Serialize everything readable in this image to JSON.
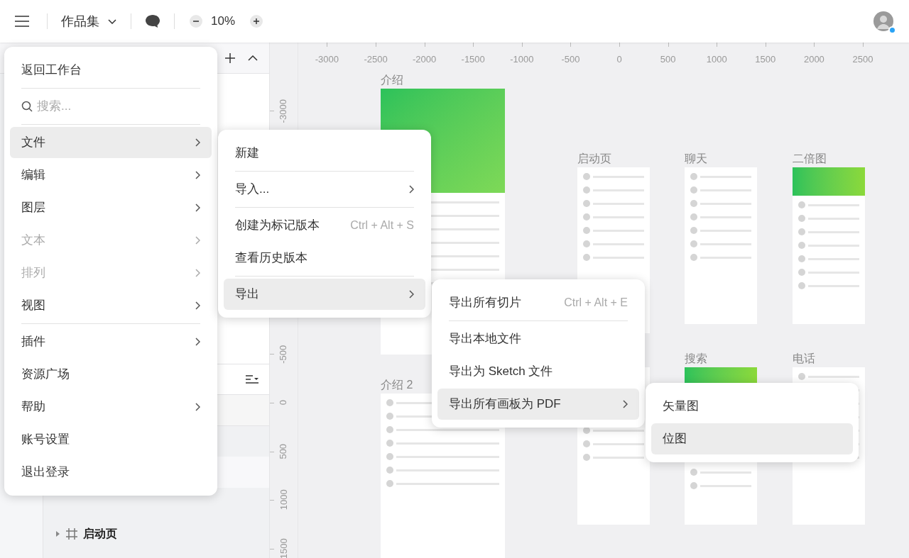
{
  "toolbar": {
    "document_title": "作品集",
    "zoom": "10%"
  },
  "rulers": {
    "horizontal": [
      "-3000",
      "-2500",
      "-2000",
      "-1500",
      "-1000",
      "-500",
      "0",
      "500",
      "1000",
      "1500",
      "2000",
      "2500"
    ],
    "vertical": [
      "-3000",
      "-500",
      "0",
      "500",
      "1000",
      "1500"
    ]
  },
  "artboards": [
    {
      "label": "介绍",
      "kind": "promo"
    },
    {
      "label": "启动页",
      "kind": "plain"
    },
    {
      "label": "聊天",
      "kind": "plain"
    },
    {
      "label": "二倍图",
      "kind": "green_header"
    },
    {
      "label": "介绍 2",
      "kind": "plain"
    },
    {
      "kind": "plain"
    },
    {
      "label": "搜索",
      "kind": "green_header"
    },
    {
      "label": "电话",
      "kind": "plain"
    }
  ],
  "layers": [
    {
      "label": "启动页",
      "expanded": false
    }
  ],
  "main_menu": [
    {
      "kind": "action",
      "label": "返回工作台",
      "selected": false,
      "disabled": false
    },
    {
      "kind": "divider"
    },
    {
      "kind": "search",
      "placeholder": "搜索..."
    },
    {
      "kind": "divider"
    },
    {
      "kind": "submenu",
      "label": "文件",
      "selected": true,
      "disabled": false
    },
    {
      "kind": "submenu",
      "label": "编辑",
      "selected": false,
      "disabled": false
    },
    {
      "kind": "submenu",
      "label": "图层",
      "selected": false,
      "disabled": false
    },
    {
      "kind": "submenu",
      "label": "文本",
      "selected": false,
      "disabled": true
    },
    {
      "kind": "submenu",
      "label": "排列",
      "selected": false,
      "disabled": true
    },
    {
      "kind": "submenu",
      "label": "视图",
      "selected": false,
      "disabled": false
    },
    {
      "kind": "divider"
    },
    {
      "kind": "submenu",
      "label": "插件",
      "selected": false,
      "disabled": false
    },
    {
      "kind": "action",
      "label": "资源广场",
      "selected": false,
      "disabled": false
    },
    {
      "kind": "submenu",
      "label": "帮助",
      "selected": false,
      "disabled": false
    },
    {
      "kind": "action",
      "label": "账号设置",
      "selected": false,
      "disabled": false
    },
    {
      "kind": "action",
      "label": "退出登录",
      "selected": false,
      "disabled": false
    }
  ],
  "file_menu": [
    {
      "kind": "action",
      "label": "新建",
      "selected": false,
      "disabled": false
    },
    {
      "kind": "divider"
    },
    {
      "kind": "submenu",
      "label": "导入...",
      "selected": false,
      "disabled": false
    },
    {
      "kind": "divider"
    },
    {
      "kind": "action",
      "label": "创建为标记版本",
      "shortcut": "Ctrl + Alt + S",
      "selected": false,
      "disabled": false
    },
    {
      "kind": "action",
      "label": "查看历史版本",
      "selected": false,
      "disabled": false
    },
    {
      "kind": "divider"
    },
    {
      "kind": "submenu",
      "label": "导出",
      "selected": true,
      "disabled": false
    }
  ],
  "export_menu": [
    {
      "kind": "action",
      "label": "导出所有切片",
      "shortcut": "Ctrl + Alt + E",
      "selected": false,
      "disabled": false
    },
    {
      "kind": "divider"
    },
    {
      "kind": "action",
      "label": "导出本地文件",
      "selected": false,
      "disabled": false
    },
    {
      "kind": "action",
      "label": "导出为 Sketch 文件",
      "selected": false,
      "disabled": false
    },
    {
      "kind": "submenu",
      "label": "导出所有画板为 PDF",
      "selected": true,
      "disabled": false
    }
  ],
  "pdf_menu": [
    {
      "kind": "action",
      "label": "矢量图",
      "selected": false,
      "disabled": false
    },
    {
      "kind": "action",
      "label": "位图",
      "selected": true,
      "disabled": false
    }
  ]
}
